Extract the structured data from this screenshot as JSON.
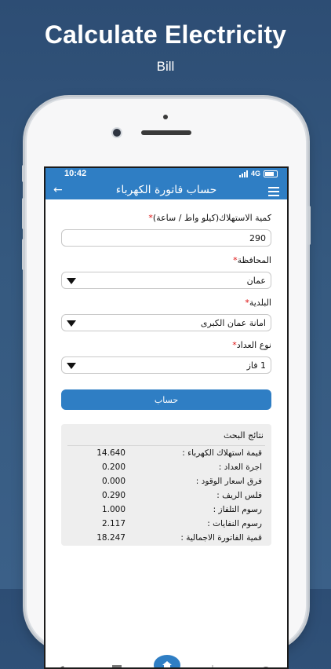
{
  "promo": {
    "title": "Calculate Electricity",
    "subtitle": "Bill"
  },
  "status_bar": {
    "time": "10:42",
    "network": "4G"
  },
  "app_bar": {
    "title": "حساب فاتورة الكهرباء",
    "back_icon": "arrow-left-icon",
    "menu_icon": "hamburger-menu-icon"
  },
  "form": {
    "consumption": {
      "label": "كمية الاستهلاك(كيلو واط / ساعة)",
      "value": "290"
    },
    "governorate": {
      "label": "المحافظة",
      "value": "عمان"
    },
    "municipality": {
      "label": "البلدية",
      "value": "امانة عمان الكبرى"
    },
    "meter_type": {
      "label": "نوع العداد",
      "value": "1 فاز"
    },
    "required_mark": "*",
    "calculate_label": "حساب"
  },
  "results": {
    "title": "نتائج البحث",
    "rows": [
      {
        "label": "قيمة استهلاك الكهرباء :",
        "value": "14.640"
      },
      {
        "label": "اجرة العداد :",
        "value": "0.200"
      },
      {
        "label": "فرق اسعار الوقود :",
        "value": "0.000"
      },
      {
        "label": "فلس الريف :",
        "value": "0.290"
      },
      {
        "label": "رسوم التلفاز :",
        "value": "1.000"
      },
      {
        "label": "رسوم النفايات :",
        "value": "2.117"
      },
      {
        "label": "قمية الفاتورة الاجمالية :",
        "value": "18.247"
      }
    ]
  },
  "bottom_nav": {
    "items": [
      "phone-icon",
      "document-icon",
      "home-icon",
      "sun-icon",
      "search-icon"
    ]
  },
  "colors": {
    "primary": "#2f7ec4",
    "background_top": "#2d4d74",
    "required": "#dd1111"
  }
}
